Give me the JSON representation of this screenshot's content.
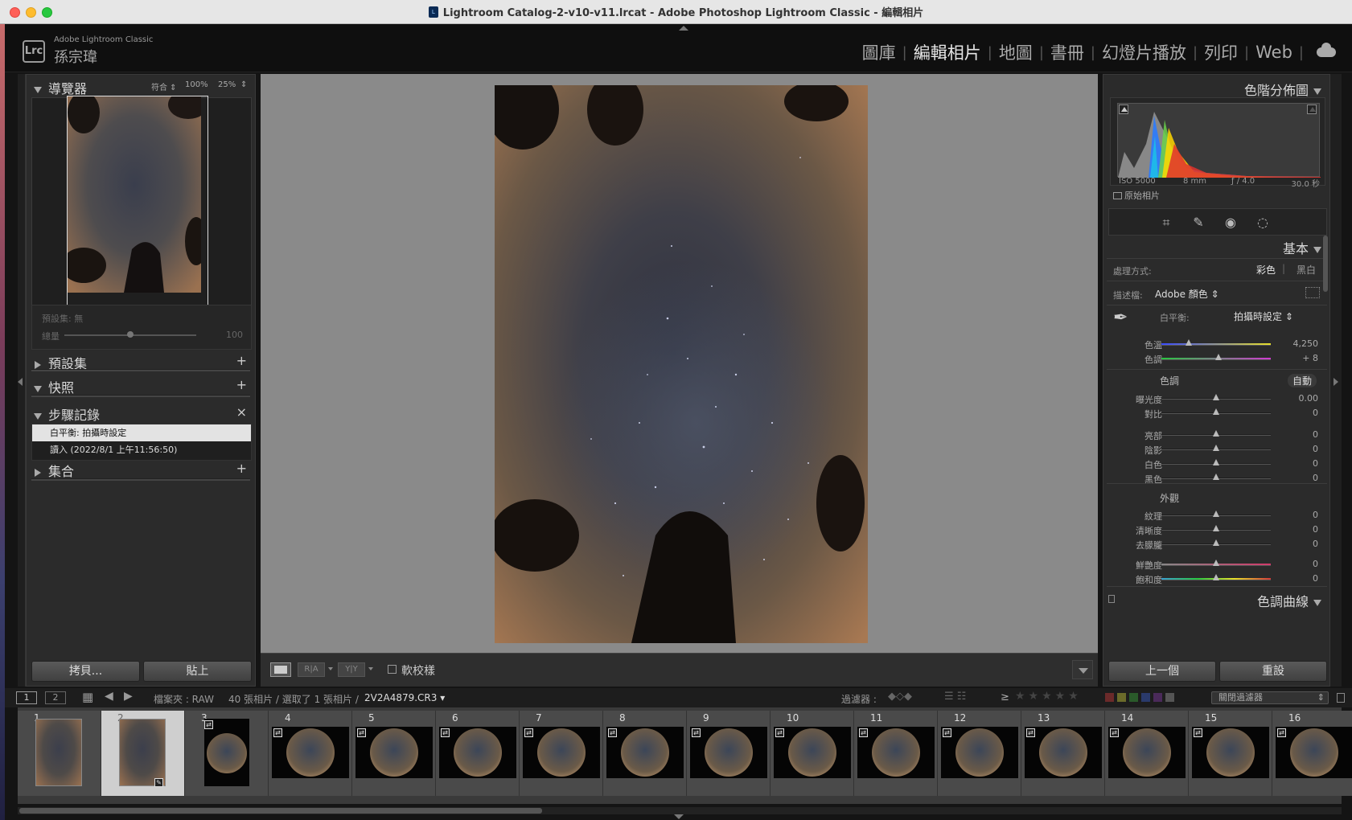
{
  "window": {
    "title": "Lightroom Catalog-2-v10-v11.lrcat - Adobe Photoshop Lightroom Classic - 編輯相片"
  },
  "identity": {
    "logo": "Lrc",
    "app_name": "Adobe Lightroom Classic",
    "user": "孫宗瑋"
  },
  "modules": [
    "圖庫",
    "編輯相片",
    "地圖",
    "書冊",
    "幻燈片播放",
    "列印",
    "Web"
  ],
  "active_module": "編輯相片",
  "left": {
    "navigator": {
      "title": "導覽器",
      "zoom_fit": "符合",
      "zoom_100": "100%",
      "zoom_25": "25%"
    },
    "preset_amount": {
      "preset_label": "預設集: 無",
      "amount_label": "總量",
      "amount_value": "100"
    },
    "presets": {
      "title": "預設集",
      "add": "+"
    },
    "snapshots": {
      "title": "快照",
      "add": "+"
    },
    "history": {
      "title": "步驟記錄",
      "clear": "×",
      "items": [
        "白平衡: 拍攝時設定",
        "讀入 (2022/8/1 上午11:56:50)"
      ]
    },
    "collections": {
      "title": "集合",
      "add": "+"
    },
    "copy_button": "拷貝...",
    "paste_button": "貼上"
  },
  "toolbar": {
    "soft_proof_label": "軟校樣"
  },
  "right": {
    "histogram": {
      "title": "色階分佈圖",
      "iso": "ISO 5000",
      "focal": "8 mm",
      "aperture": "ƒ / 4.0",
      "shutter": "30.0 秒",
      "original_photo": "原始相片"
    },
    "basic": {
      "title": "基本",
      "treatment_label": "處理方式:",
      "color": "彩色",
      "bw": "黑白",
      "profile_label": "描述檔:",
      "profile_value": "Adobe 顏色",
      "wb_label": "白平衡:",
      "wb_value": "拍攝時設定",
      "temp": {
        "label": "色溫",
        "value": "4,250",
        "pos": 0.25
      },
      "tint": {
        "label": "色調",
        "value": "+ 8",
        "pos": 0.52
      },
      "tone_label": "色調",
      "auto": "自動",
      "exposure": {
        "label": "曝光度",
        "value": "0.00",
        "pos": 0.5
      },
      "contrast": {
        "label": "對比",
        "value": "0",
        "pos": 0.5
      },
      "highlights": {
        "label": "亮部",
        "value": "0",
        "pos": 0.5
      },
      "shadows": {
        "label": "陰影",
        "value": "0",
        "pos": 0.5
      },
      "whites": {
        "label": "白色",
        "value": "0",
        "pos": 0.5
      },
      "blacks": {
        "label": "黑色",
        "value": "0",
        "pos": 0.5
      },
      "presence_label": "外觀",
      "texture": {
        "label": "紋理",
        "value": "0",
        "pos": 0.5
      },
      "clarity": {
        "label": "清晰度",
        "value": "0",
        "pos": 0.5
      },
      "dehaze": {
        "label": "去朦朧",
        "value": "0",
        "pos": 0.5
      },
      "vibrance": {
        "label": "鮮艷度",
        "value": "0",
        "pos": 0.5
      },
      "saturation": {
        "label": "飽和度",
        "value": "0",
        "pos": 0.5
      }
    },
    "tone_curve": {
      "title": "色調曲線"
    },
    "previous_button": "上一個",
    "reset_button": "重設"
  },
  "filmbar": {
    "view1": "1",
    "view2": "2",
    "folder": "檔案夾 : RAW",
    "count": "40 張相片 / 選取了 1 張相片 /",
    "filename": "2V2A4879.CR3",
    "filter_label": "過濾器 :",
    "gte": "≥",
    "filter_off": "關閉過濾器"
  },
  "filmstrip": [
    {
      "num": "1",
      "kind": "portrait",
      "selected": false
    },
    {
      "num": "2",
      "kind": "portrait",
      "selected": true
    },
    {
      "num": "3",
      "kind": "round-small",
      "selected": false
    },
    {
      "num": "4",
      "kind": "round",
      "selected": false
    },
    {
      "num": "5",
      "kind": "round",
      "selected": false
    },
    {
      "num": "6",
      "kind": "round",
      "selected": false
    },
    {
      "num": "7",
      "kind": "round",
      "selected": false
    },
    {
      "num": "8",
      "kind": "round",
      "selected": false
    },
    {
      "num": "9",
      "kind": "round",
      "selected": false
    },
    {
      "num": "10",
      "kind": "round",
      "selected": false
    },
    {
      "num": "11",
      "kind": "round",
      "selected": false
    },
    {
      "num": "12",
      "kind": "round",
      "selected": false
    },
    {
      "num": "13",
      "kind": "round",
      "selected": false
    },
    {
      "num": "14",
      "kind": "round",
      "selected": false
    },
    {
      "num": "15",
      "kind": "round",
      "selected": false
    },
    {
      "num": "16",
      "kind": "round",
      "selected": false
    }
  ]
}
